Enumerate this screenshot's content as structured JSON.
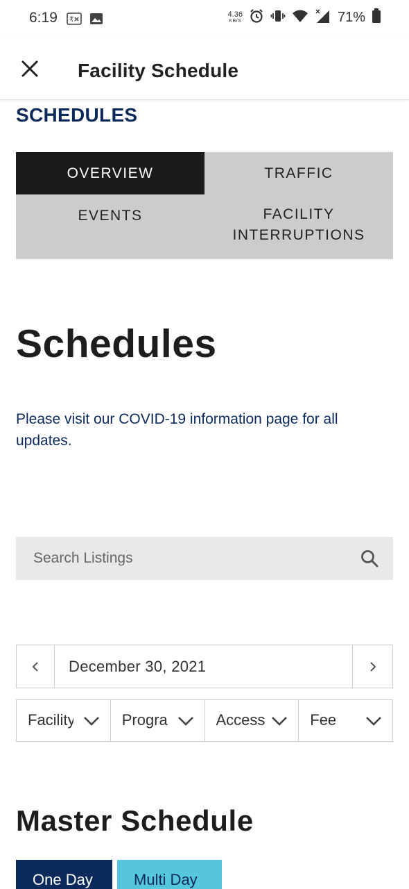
{
  "status_bar": {
    "time": "6:19",
    "network_speed": "4.36",
    "network_unit": "KB/S",
    "battery": "71%"
  },
  "header": {
    "title": "Facility Schedule",
    "close_icon": "close-icon"
  },
  "section_heading": "SCHEDULES",
  "tabs": [
    {
      "label": "OVERVIEW",
      "active": true
    },
    {
      "label": "TRAFFIC",
      "active": false
    },
    {
      "label": "EVENTS",
      "active": false
    },
    {
      "label": "FACILITY INTERRUPTIONS",
      "active": false
    }
  ],
  "page_title": "Schedules",
  "covid_notice": "Please visit our COVID-19 information page for all updates.",
  "search": {
    "placeholder": "Search Listings",
    "icon": "search-icon"
  },
  "date_nav": {
    "date": "December 30, 2021",
    "prev_icon": "chevron-left-icon",
    "next_icon": "chevron-right-icon"
  },
  "filters": [
    {
      "label": "Facility"
    },
    {
      "label": "Program"
    },
    {
      "label": "Access"
    },
    {
      "label": "Fee"
    }
  ],
  "master_schedule": {
    "title": "Master Schedule",
    "one_day": "One Day",
    "multi_day": "Multi Day"
  },
  "colors": {
    "brand_navy": "#0b2a5b",
    "accent_cyan": "#56c5de",
    "tab_active": "#1b1b1b",
    "tab_inactive": "#cccccc"
  }
}
